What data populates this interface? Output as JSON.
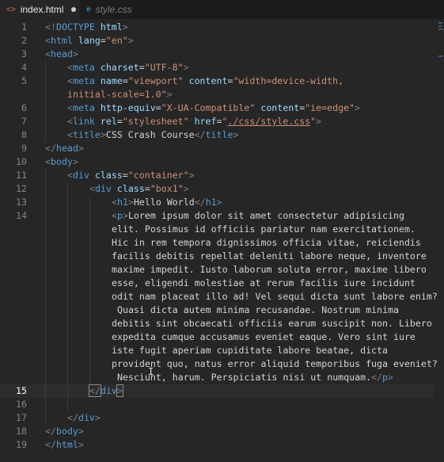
{
  "tabs": [
    {
      "label": "index.html",
      "icon": "html-file-icon",
      "active": true,
      "modified": true
    },
    {
      "label": "style.css",
      "icon": "hash-icon",
      "active": false,
      "modified": false
    }
  ],
  "current_line": 15,
  "code_lines": [
    {
      "n": "1",
      "indent": 0,
      "tokens": [
        [
          "p",
          "<!"
        ],
        [
          "d",
          "DOCTYPE"
        ],
        [
          "x",
          " "
        ],
        [
          "a",
          "html"
        ],
        [
          "p",
          ">"
        ]
      ]
    },
    {
      "n": "2",
      "indent": 0,
      "tokens": [
        [
          "p",
          "<"
        ],
        [
          "t",
          "html"
        ],
        [
          "x",
          " "
        ],
        [
          "a",
          "lang"
        ],
        [
          "x",
          "="
        ],
        [
          "s",
          "\"en\""
        ],
        [
          "p",
          ">"
        ]
      ]
    },
    {
      "n": "3",
      "indent": 0,
      "tokens": [
        [
          "p",
          "<"
        ],
        [
          "t",
          "head"
        ],
        [
          "p",
          ">"
        ]
      ]
    },
    {
      "n": "4",
      "indent": 1,
      "tokens": [
        [
          "p",
          "<"
        ],
        [
          "t",
          "meta"
        ],
        [
          "x",
          " "
        ],
        [
          "a",
          "charset"
        ],
        [
          "x",
          "="
        ],
        [
          "s",
          "\"UTF-8\""
        ],
        [
          "p",
          ">"
        ]
      ]
    },
    {
      "n": "5",
      "indent": 1,
      "tokens": [
        [
          "p",
          "<"
        ],
        [
          "t",
          "meta"
        ],
        [
          "x",
          " "
        ],
        [
          "a",
          "name"
        ],
        [
          "x",
          "="
        ],
        [
          "s",
          "\"viewport\""
        ],
        [
          "x",
          " "
        ],
        [
          "a",
          "content"
        ],
        [
          "x",
          "="
        ],
        [
          "s",
          "\"width=device-width,"
        ]
      ]
    },
    {
      "n": "",
      "indent": 1,
      "tokens": [
        [
          "s",
          "initial-scale=1.0\""
        ],
        [
          "p",
          ">"
        ]
      ]
    },
    {
      "n": "6",
      "indent": 1,
      "tokens": [
        [
          "p",
          "<"
        ],
        [
          "t",
          "meta"
        ],
        [
          "x",
          " "
        ],
        [
          "a",
          "http-equiv"
        ],
        [
          "x",
          "="
        ],
        [
          "s",
          "\"X-UA-Compatible\""
        ],
        [
          "x",
          " "
        ],
        [
          "a",
          "content"
        ],
        [
          "x",
          "="
        ],
        [
          "s",
          "\"ie=edge\""
        ],
        [
          "p",
          ">"
        ]
      ]
    },
    {
      "n": "7",
      "indent": 1,
      "tokens": [
        [
          "p",
          "<"
        ],
        [
          "t",
          "link"
        ],
        [
          "x",
          " "
        ],
        [
          "a",
          "rel"
        ],
        [
          "x",
          "="
        ],
        [
          "s",
          "\"stylesheet\""
        ],
        [
          "x",
          " "
        ],
        [
          "a",
          "href"
        ],
        [
          "x",
          "="
        ],
        [
          "s",
          "\""
        ],
        [
          "su",
          "./css/style.css"
        ],
        [
          "s",
          "\""
        ],
        [
          "p",
          ">"
        ]
      ]
    },
    {
      "n": "8",
      "indent": 1,
      "tokens": [
        [
          "p",
          "<"
        ],
        [
          "t",
          "title"
        ],
        [
          "p",
          ">"
        ],
        [
          "x",
          "CSS Crash Course"
        ],
        [
          "p",
          "</"
        ],
        [
          "t",
          "title"
        ],
        [
          "p",
          ">"
        ]
      ]
    },
    {
      "n": "9",
      "indent": 0,
      "tokens": [
        [
          "p",
          "</"
        ],
        [
          "t",
          "head"
        ],
        [
          "p",
          ">"
        ]
      ]
    },
    {
      "n": "10",
      "indent": 0,
      "tokens": [
        [
          "p",
          "<"
        ],
        [
          "t",
          "body"
        ],
        [
          "p",
          ">"
        ]
      ]
    },
    {
      "n": "11",
      "indent": 1,
      "tokens": [
        [
          "p",
          "<"
        ],
        [
          "t",
          "div"
        ],
        [
          "x",
          " "
        ],
        [
          "a",
          "class"
        ],
        [
          "x",
          "="
        ],
        [
          "s",
          "\"container\""
        ],
        [
          "p",
          ">"
        ]
      ]
    },
    {
      "n": "12",
      "indent": 2,
      "tokens": [
        [
          "p",
          "<"
        ],
        [
          "t",
          "div"
        ],
        [
          "x",
          " "
        ],
        [
          "a",
          "class"
        ],
        [
          "x",
          "="
        ],
        [
          "s",
          "\"box1\""
        ],
        [
          "p",
          ">"
        ]
      ]
    },
    {
      "n": "13",
      "indent": 3,
      "tokens": [
        [
          "p",
          "<"
        ],
        [
          "t",
          "h1"
        ],
        [
          "p",
          ">"
        ],
        [
          "x",
          "Hello World"
        ],
        [
          "p",
          "</"
        ],
        [
          "t",
          "h1"
        ],
        [
          "p",
          ">"
        ]
      ]
    },
    {
      "n": "14",
      "indent": 3,
      "tokens": [
        [
          "p",
          "<"
        ],
        [
          "t",
          "p"
        ],
        [
          "p",
          ">"
        ],
        [
          "x",
          "Lorem ipsum dolor sit amet consectetur adipisicing"
        ]
      ]
    },
    {
      "n": "",
      "indent": 3,
      "tokens": [
        [
          "x",
          "elit. Possimus id officiis pariatur nam exercitationem."
        ]
      ]
    },
    {
      "n": "",
      "indent": 3,
      "tokens": [
        [
          "x",
          "Hic in rem tempora dignissimos officia vitae, reiciendis"
        ]
      ]
    },
    {
      "n": "",
      "indent": 3,
      "tokens": [
        [
          "x",
          "facilis debitis repellat deleniti labore neque, inventore"
        ]
      ]
    },
    {
      "n": "",
      "indent": 3,
      "tokens": [
        [
          "x",
          "maxime impedit. Iusto laborum soluta error, maxime libero"
        ]
      ]
    },
    {
      "n": "",
      "indent": 3,
      "tokens": [
        [
          "x",
          "esse, eligendi molestiae at rerum facilis iure incidunt"
        ]
      ]
    },
    {
      "n": "",
      "indent": 3,
      "tokens": [
        [
          "x",
          "odit nam placeat illo ad! Vel sequi dicta sunt labore enim?"
        ]
      ]
    },
    {
      "n": "",
      "indent": 3,
      "tokens": [
        [
          "x",
          " Quasi dicta autem minima recusandae. Nostrum minima"
        ]
      ]
    },
    {
      "n": "",
      "indent": 3,
      "tokens": [
        [
          "x",
          "debitis sint obcaecati officiis earum suscipit non. Libero"
        ]
      ]
    },
    {
      "n": "",
      "indent": 3,
      "tokens": [
        [
          "x",
          "expedita cumque accusamus eveniet eaque. Vero sint iure"
        ]
      ]
    },
    {
      "n": "",
      "indent": 3,
      "tokens": [
        [
          "x",
          "iste fugit aperiam cupiditate labore beatae, dicta"
        ]
      ]
    },
    {
      "n": "",
      "indent": 3,
      "tokens": [
        [
          "x",
          "provident quo, natus error aliquid temporibus fuga eveniet?"
        ]
      ]
    },
    {
      "n": "",
      "indent": 3,
      "tokens": [
        [
          "x",
          " Nesciunt, harum. Perspiciatis nisi ut numquam."
        ],
        [
          "p",
          "</"
        ],
        [
          "t",
          "p"
        ],
        [
          "p",
          ">"
        ]
      ]
    },
    {
      "n": "15",
      "indent": 2,
      "tokens": [
        [
          "pb",
          "</"
        ],
        [
          "t",
          "div"
        ],
        [
          "pb",
          ">"
        ]
      ]
    },
    {
      "n": "16",
      "indent": 2,
      "tokens": []
    },
    {
      "n": "17",
      "indent": 1,
      "tokens": [
        [
          "p",
          "</"
        ],
        [
          "t",
          "div"
        ],
        [
          "p",
          ">"
        ]
      ]
    },
    {
      "n": "18",
      "indent": 0,
      "tokens": [
        [
          "p",
          "</"
        ],
        [
          "t",
          "body"
        ],
        [
          "p",
          ">"
        ]
      ]
    },
    {
      "n": "19",
      "indent": 0,
      "tokens": [
        [
          "p",
          "</"
        ],
        [
          "t",
          "html"
        ],
        [
          "p",
          ">"
        ]
      ]
    }
  ]
}
